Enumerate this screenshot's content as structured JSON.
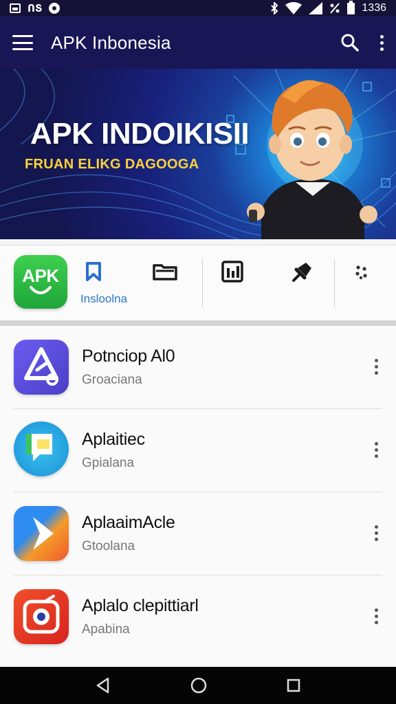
{
  "status_bar": {
    "left_text": "ՈՏ",
    "time": "1336"
  },
  "app_bar": {
    "title": "APK Inbonesia",
    "search_icon": "search-icon",
    "more_icon": "more-vert-icon"
  },
  "banner": {
    "title": "APK INDOIKISII",
    "subtitle": "FRUAN ELIKG DAGOOGA",
    "colors": {
      "title": "#ffffff",
      "subtitle": "#ffd23a",
      "background": "#18207a"
    }
  },
  "shortcuts": {
    "logo_text": "APK",
    "active_label": "Insloolna",
    "items": [
      {
        "icon": "bookmark-icon"
      },
      {
        "icon": "folder-icon"
      },
      {
        "icon": "calendar-grid-icon"
      },
      {
        "icon": "pin-icon"
      },
      {
        "icon": "dots-grid-icon"
      }
    ],
    "accent": "#2b7fd0"
  },
  "apps": [
    {
      "name": "Potnciop Al0",
      "category": "Groaciana",
      "icon": "triangle-app-icon"
    },
    {
      "name": "Aplaitiec",
      "category": "Gpialana",
      "icon": "chat-bubble-app-icon"
    },
    {
      "name": "AplaaimAcle",
      "category": "Gtoolana",
      "icon": "play-arrow-app-icon"
    },
    {
      "name": "Aplalo clepittiarl",
      "category": "Apabina",
      "icon": "camera-app-icon"
    }
  ],
  "nav": {
    "back_icon": "back-icon",
    "home_icon": "home-icon",
    "recents_icon": "recents-icon"
  }
}
